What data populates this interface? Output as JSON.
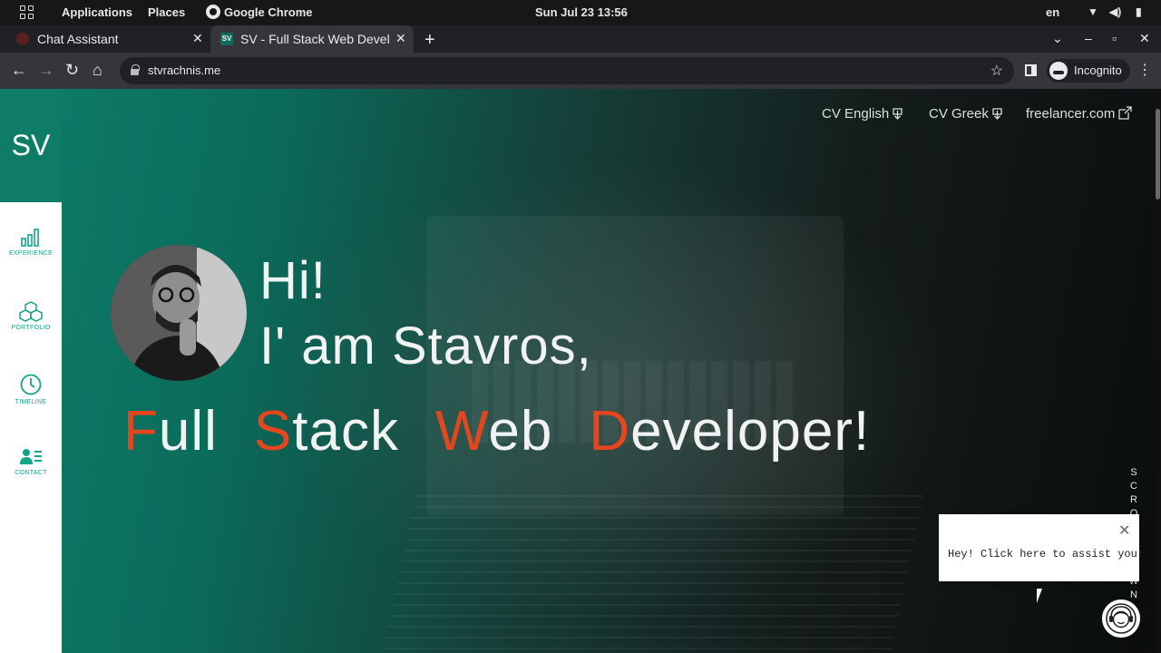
{
  "system_bar": {
    "applications": "Applications",
    "places": "Places",
    "app_name": "Google Chrome",
    "datetime": "Sun Jul 23  13:56",
    "language": "en"
  },
  "browser": {
    "tabs": [
      {
        "label": "Chat Assistant"
      },
      {
        "label": "SV - Full Stack Web Developer"
      }
    ],
    "url": "stvrachnis.me",
    "profile": "Incognito",
    "favicon_text": "SV"
  },
  "site": {
    "logo": "SV",
    "nav": [
      {
        "label": "EXPERIENCE",
        "icon": "bar-chart-icon"
      },
      {
        "label": "PORTFOLIO",
        "icon": "cubes-icon"
      },
      {
        "label": "TIMELINE",
        "icon": "clock-icon"
      },
      {
        "label": "CONTACT",
        "icon": "contact-card-icon"
      }
    ],
    "top_links": [
      {
        "label": "CV English",
        "icon": "download-icon"
      },
      {
        "label": "CV Greek",
        "icon": "download-icon"
      },
      {
        "label": "freelancer.com",
        "icon": "external-link-icon"
      }
    ],
    "greeting": "Hi!",
    "intro": "I' am  Stavros,",
    "role": [
      {
        "cap": "F",
        "rest": "ull"
      },
      {
        "cap": "S",
        "rest": "tack"
      },
      {
        "cap": "W",
        "rest": "eb"
      },
      {
        "cap": "D",
        "rest": "eveloper!"
      }
    ],
    "scroll_letters": [
      "S",
      "C",
      "R",
      "O",
      "L",
      "L",
      "D",
      "O",
      "W",
      "N"
    ],
    "accent_color": "#e6461e",
    "brand_color": "#0f7c68"
  },
  "chat_widget": {
    "message": "Hey! Click here to assist you!"
  }
}
